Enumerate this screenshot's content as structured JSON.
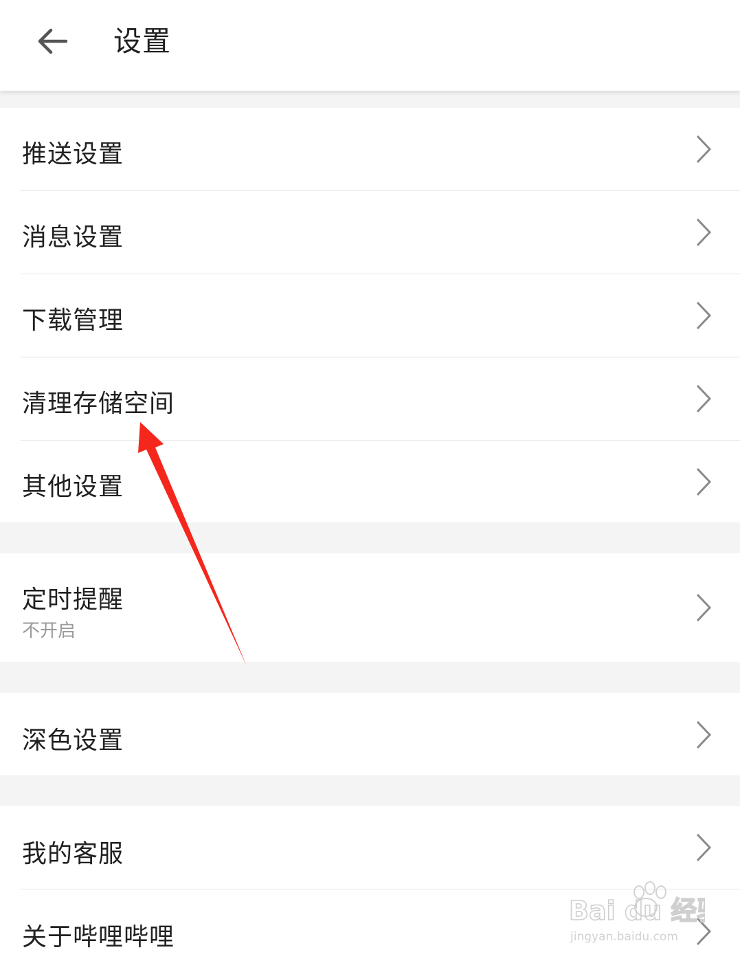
{
  "header": {
    "title": "设置",
    "back_icon": "back-arrow-icon"
  },
  "groups": [
    {
      "items": [
        {
          "label": "推送设置"
        },
        {
          "label": "消息设置"
        },
        {
          "label": "下载管理"
        },
        {
          "label": "清理存储空间"
        },
        {
          "label": "其他设置"
        }
      ]
    },
    {
      "items": [
        {
          "label": "定时提醒",
          "sub": "不开启"
        }
      ]
    },
    {
      "items": [
        {
          "label": "深色设置"
        }
      ]
    },
    {
      "items": [
        {
          "label": "我的客服"
        },
        {
          "label": "关于哔哩哔哩"
        }
      ]
    }
  ],
  "annotation": {
    "color": "#f5271d"
  },
  "watermark": {
    "brand": "Bai du 经验",
    "url": "jingyan.baidu.com"
  }
}
